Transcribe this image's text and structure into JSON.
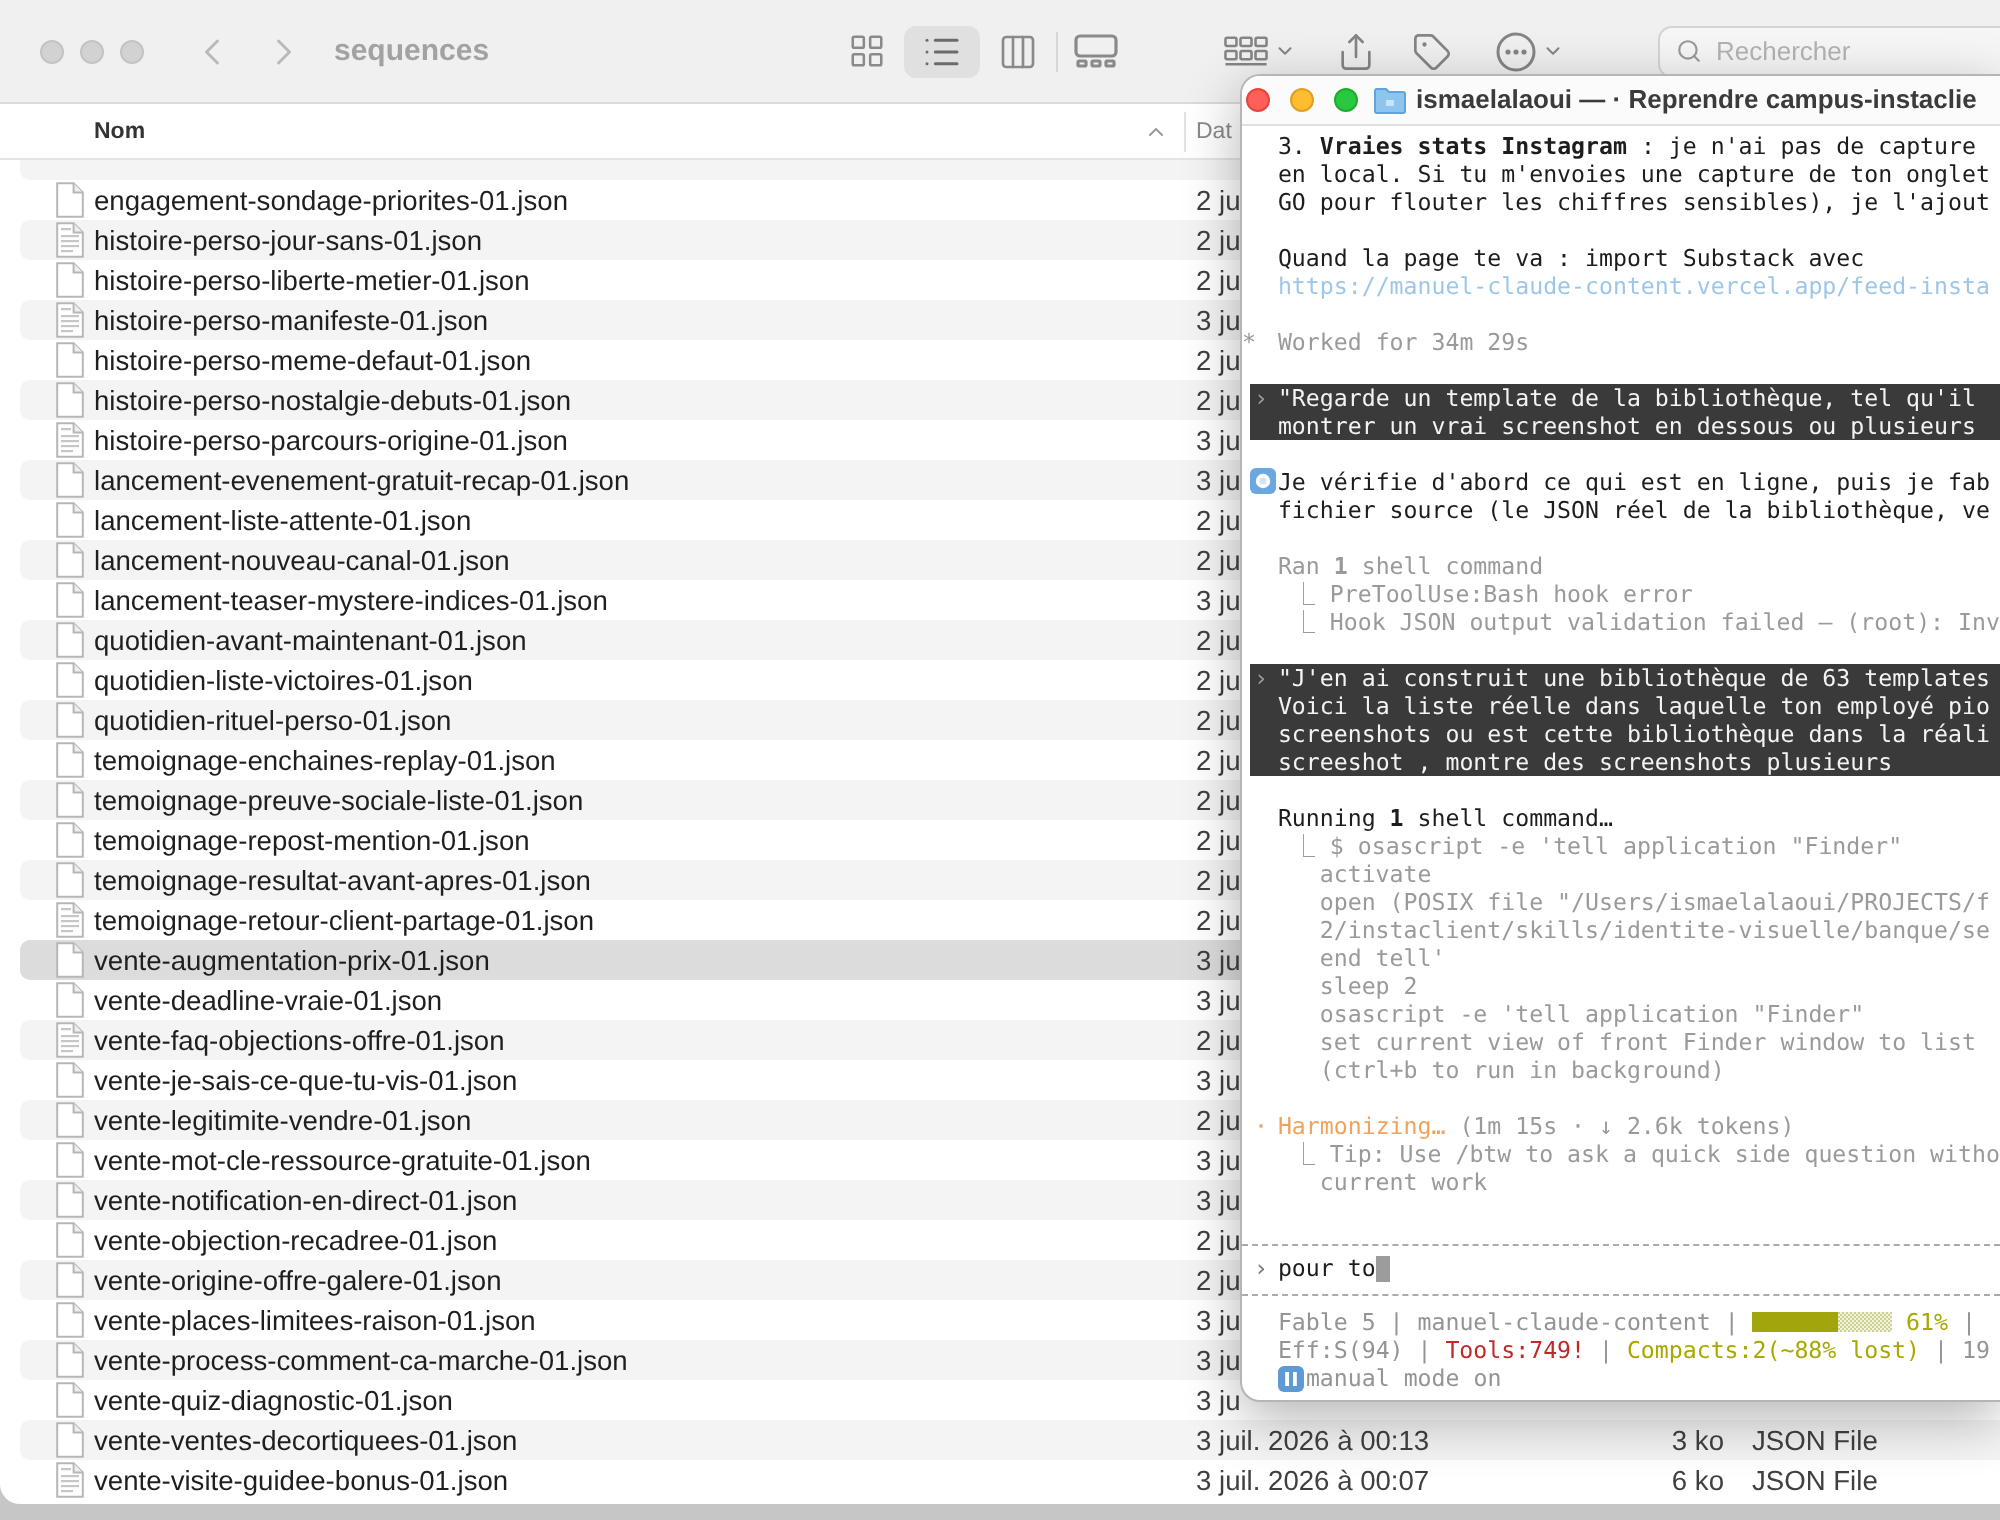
{
  "finder": {
    "active": false,
    "title": "sequences",
    "view_modes": [
      {
        "kind": "icons",
        "selected": false
      },
      {
        "kind": "list",
        "selected": true
      },
      {
        "kind": "columns",
        "selected": false
      },
      {
        "kind": "gallery",
        "selected": false
      }
    ],
    "search": {
      "placeholder": "Rechercher"
    },
    "columns": [
      {
        "label": "Nom",
        "sorted": true
      },
      {
        "label": "Dat",
        "sorted": false
      }
    ],
    "rows": [
      {
        "name": "engagement-sondage-priorites-01.json",
        "date": "2 ju",
        "selected": false,
        "preview": false
      },
      {
        "name": "histoire-perso-jour-sans-01.json",
        "date": "2 ju",
        "selected": false,
        "preview": true
      },
      {
        "name": "histoire-perso-liberte-metier-01.json",
        "date": "2 ju",
        "selected": false,
        "preview": false
      },
      {
        "name": "histoire-perso-manifeste-01.json",
        "date": "3 ju",
        "selected": false,
        "preview": true
      },
      {
        "name": "histoire-perso-meme-defaut-01.json",
        "date": "2 ju",
        "selected": false,
        "preview": false
      },
      {
        "name": "histoire-perso-nostalgie-debuts-01.json",
        "date": "2 ju",
        "selected": false,
        "preview": false
      },
      {
        "name": "histoire-perso-parcours-origine-01.json",
        "date": "3 ju",
        "selected": false,
        "preview": true
      },
      {
        "name": "lancement-evenement-gratuit-recap-01.json",
        "date": "3 ju",
        "selected": false,
        "preview": false
      },
      {
        "name": "lancement-liste-attente-01.json",
        "date": "2 ju",
        "selected": false,
        "preview": false
      },
      {
        "name": "lancement-nouveau-canal-01.json",
        "date": "2 ju",
        "selected": false,
        "preview": false
      },
      {
        "name": "lancement-teaser-mystere-indices-01.json",
        "date": "3 ju",
        "selected": false,
        "preview": false
      },
      {
        "name": "quotidien-avant-maintenant-01.json",
        "date": "2 ju",
        "selected": false,
        "preview": false
      },
      {
        "name": "quotidien-liste-victoires-01.json",
        "date": "2 ju",
        "selected": false,
        "preview": false
      },
      {
        "name": "quotidien-rituel-perso-01.json",
        "date": "2 ju",
        "selected": false,
        "preview": false
      },
      {
        "name": "temoignage-enchaines-replay-01.json",
        "date": "2 ju",
        "selected": false,
        "preview": false
      },
      {
        "name": "temoignage-preuve-sociale-liste-01.json",
        "date": "2 ju",
        "selected": false,
        "preview": false
      },
      {
        "name": "temoignage-repost-mention-01.json",
        "date": "2 ju",
        "selected": false,
        "preview": false
      },
      {
        "name": "temoignage-resultat-avant-apres-01.json",
        "date": "2 ju",
        "selected": false,
        "preview": false
      },
      {
        "name": "temoignage-retour-client-partage-01.json",
        "date": "2 ju",
        "selected": false,
        "preview": true
      },
      {
        "name": "vente-augmentation-prix-01.json",
        "date": "3 ju",
        "selected": true,
        "preview": false
      },
      {
        "name": "vente-deadline-vraie-01.json",
        "date": "3 ju",
        "selected": false,
        "preview": false
      },
      {
        "name": "vente-faq-objections-offre-01.json",
        "date": "2 ju",
        "selected": false,
        "preview": true
      },
      {
        "name": "vente-je-sais-ce-que-tu-vis-01.json",
        "date": "3 ju",
        "selected": false,
        "preview": false
      },
      {
        "name": "vente-legitimite-vendre-01.json",
        "date": "2 ju",
        "selected": false,
        "preview": false
      },
      {
        "name": "vente-mot-cle-ressource-gratuite-01.json",
        "date": "3 ju",
        "selected": false,
        "preview": false
      },
      {
        "name": "vente-notification-en-direct-01.json",
        "date": "3 ju",
        "selected": false,
        "preview": false
      },
      {
        "name": "vente-objection-recadree-01.json",
        "date": "2 ju",
        "selected": false,
        "preview": false
      },
      {
        "name": "vente-origine-offre-galere-01.json",
        "date": "2 ju",
        "selected": false,
        "preview": false
      },
      {
        "name": "vente-places-limitees-raison-01.json",
        "date": "3 ju",
        "selected": false,
        "preview": false
      },
      {
        "name": "vente-process-comment-ca-marche-01.json",
        "date": "3 ju",
        "selected": false,
        "preview": false
      },
      {
        "name": "vente-quiz-diagnostic-01.json",
        "date": "3 ju",
        "selected": false,
        "preview": false
      },
      {
        "name": "vente-ventes-decortiquees-01.json",
        "date": "3 juil. 2026 à 00:13",
        "column_3": "3 ko",
        "column_4": "JSON File",
        "selected": false,
        "preview": false
      },
      {
        "name": "vente-visite-guidee-bonus-01.json",
        "date": "3 juil. 2026 à 00:07",
        "column_3": "6 ko",
        "column_4": "JSON File",
        "selected": false,
        "preview": true
      }
    ]
  },
  "terminal": {
    "active": true,
    "title": "ismaelalaoui — · Reprendre campus-instaclie",
    "blocks": [
      {
        "kind": "reply",
        "lines": [
          {
            "kind": "text",
            "text": "3. **Vraies stats Instagram** : je n'ai pas de capture"
          },
          {
            "kind": "text",
            "text": "en local. Si tu m'envoies une capture de ton onglet"
          },
          {
            "kind": "text",
            "text": "GO pour flouter les chiffres sensibles), je l'ajout"
          }
        ]
      },
      {
        "kind": "reply",
        "lines": [
          {
            "kind": "text",
            "text": "Quand la page te va : import Substack avec"
          },
          {
            "kind": "link",
            "text": "https://manuel-claude-content.vercel.app/feed-insta"
          }
        ]
      },
      {
        "kind": "note",
        "marker": "*",
        "lines": [
          {
            "kind": "dim",
            "text": "Worked for 34m 29s"
          }
        ]
      },
      {
        "kind": "user",
        "marker": "›",
        "lines": [
          {
            "kind": "text",
            "text": "\"Regarde un template de la bibliothèque, tel qu'il"
          },
          {
            "kind": "text",
            "text": "montrer un vrai screenshot en dessous ou plusieurs"
          }
        ]
      },
      {
        "kind": "assistant",
        "lines": [
          {
            "kind": "text",
            "text": "Je vérifie d'abord ce qui est en ligne, puis je fab"
          },
          {
            "kind": "text",
            "text": "fichier source (le JSON réel de la bibliothèque, ve"
          }
        ]
      },
      {
        "kind": "tool",
        "lines": [
          {
            "kind": "dim",
            "text": "Ran **1** shell command"
          },
          {
            "kind": "branch",
            "text": "⎿ PreToolUse:Bash hook error"
          },
          {
            "kind": "branch",
            "text": "⎿ Hook JSON output validation failed — (root): Inv"
          }
        ]
      },
      {
        "kind": "user",
        "marker": "›",
        "lines": [
          {
            "kind": "text",
            "text": "\"J'en ai construit une bibliothèque de 63 templates"
          },
          {
            "kind": "text",
            "text": "Voici la liste réelle dans laquelle ton employé pio"
          },
          {
            "kind": "text",
            "text": "screenshots ou est cette bibliothèque dans la réali"
          },
          {
            "kind": "text",
            "text": "screeshot , montre des screenshots plusieurs"
          }
        ]
      },
      {
        "kind": "tool",
        "lines": [
          {
            "kind": "text",
            "text": "Running **1** shell command…"
          },
          {
            "kind": "branch",
            "text": "⎿ $ osascript -e 'tell application \"Finder\""
          },
          {
            "kind": "cont",
            "text": "activate"
          },
          {
            "kind": "cont",
            "text": "open (POSIX file \"/Users/ismaelalaoui/PROJECTS/f"
          },
          {
            "kind": "cont",
            "text": "2/instaclient/skills/identite-visuelle/banque/se"
          },
          {
            "kind": "cont",
            "text": "end tell'"
          },
          {
            "kind": "cont",
            "text": "sleep 2"
          },
          {
            "kind": "cont",
            "text": "osascript -e 'tell application \"Finder\""
          },
          {
            "kind": "cont",
            "text": "set current view of front Finder window to list"
          },
          {
            "kind": "cont",
            "text": "(ctrl+b to run in background)"
          }
        ]
      },
      {
        "kind": "progress",
        "marker": "·",
        "lines": [
          {
            "kind": "progress",
            "label": "Harmonizing…",
            "detail": "(1m 15s · ↓ 2.6k tokens)"
          },
          {
            "kind": "branch",
            "text": "⎿ Tip: Use /btw to ask a quick side question witho"
          },
          {
            "kind": "cont",
            "text": "current work"
          }
        ]
      }
    ],
    "prompt": {
      "marker": "›",
      "value": "pour to"
    },
    "statusline": [
      {
        "segments": [
          {
            "kind": "dim",
            "text": "Fable 5 | manuel-claude-content |"
          },
          {
            "kind": "meter",
            "level": 0.61
          },
          {
            "kind": "accent",
            "text": "61%"
          },
          {
            "kind": "dim",
            "text": "|"
          }
        ]
      },
      {
        "segments": [
          {
            "kind": "dim",
            "text": "Eff:S(94) |"
          },
          {
            "kind": "alert",
            "text": "Tools:749!"
          },
          {
            "kind": "dim",
            "text": "|"
          },
          {
            "kind": "accent",
            "text": "Compacts:2(~88% lost)"
          },
          {
            "kind": "dim",
            "text": "| 19"
          }
        ]
      },
      {
        "segments": [
          {
            "kind": "pause"
          },
          {
            "kind": "dim",
            "text": "manual mode on"
          }
        ]
      }
    ]
  }
}
